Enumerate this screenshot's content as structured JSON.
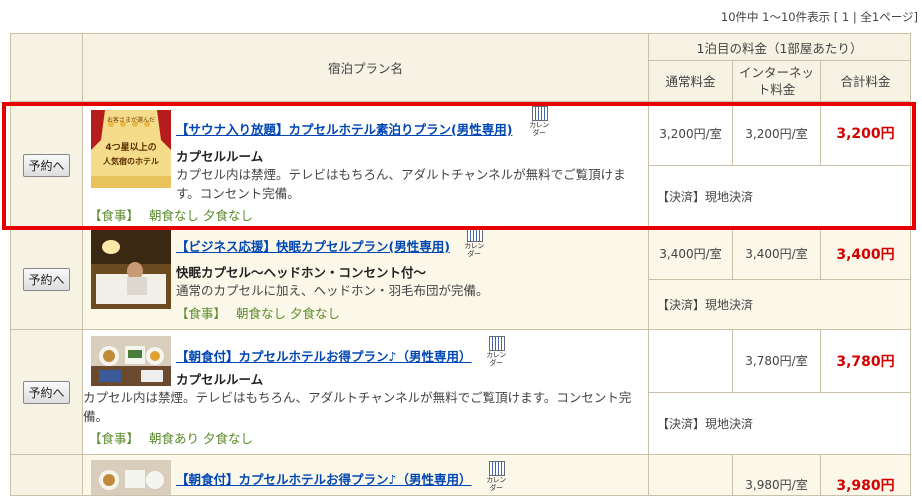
{
  "result_info": "10件中 1～10件表示 [ 1 | 全1ページ]",
  "header": {
    "plan_name": "宿泊プラン名",
    "rate_group": "1泊目の料金（1部屋あたり）",
    "regular": "通常料金",
    "internet": "インターネット料金",
    "total": "合計料金"
  },
  "reserve_label": "予約へ",
  "calendar_label": "カレンダー",
  "plans": [
    {
      "title": "【サウナ入り放題】カプセルホテル素泊りプラン(男性専用)",
      "room": "カプセルルーム",
      "description": "カプセル内は禁煙。テレビはもちろん、アダルトチャンネルが無料でご覧頂けます。コンセント完備。",
      "meal_label": "【食事】",
      "meal": "朝食なし 夕食なし",
      "regular_price": "3,200円/室",
      "internet_price": "3,200円/室",
      "total_price": "3,200円",
      "payment": "【決済】現地決済",
      "thumb_text_top": "お客さまが選んだ",
      "thumb_text_mid": "4つ星以上の",
      "thumb_text_bot": "人気宿のホテル"
    },
    {
      "title": "【ビジネス応援】快眠カプセルプラン(男性専用)",
      "room": "快眠カプセル～ヘッドホン・コンセント付～",
      "description": "通常のカプセルに加え、ヘッドホン・羽毛布団が完備。",
      "meal_label": "【食事】",
      "meal": "朝食なし 夕食なし",
      "regular_price": "3,400円/室",
      "internet_price": "3,400円/室",
      "total_price": "3,400円",
      "payment": "【決済】現地決済"
    },
    {
      "title": "【朝食付】カプセルホテルお得プラン♪（男性専用）",
      "room": "カプセルルーム",
      "description": "カプセル内は禁煙。テレビはもちろん、アダルトチャンネルが無料でご覧頂けます。コンセント完備。",
      "meal_label": "【食事】",
      "meal": "朝食あり 夕食なし",
      "regular_price": "",
      "internet_price": "3,780円/室",
      "total_price": "3,780円",
      "payment": "【決済】現地決済"
    },
    {
      "title": "【朝食付】カプセルホテルお得プラン♪（男性専用）",
      "internet_price": "3,980円/室",
      "total_price": "3,980円"
    }
  ]
}
